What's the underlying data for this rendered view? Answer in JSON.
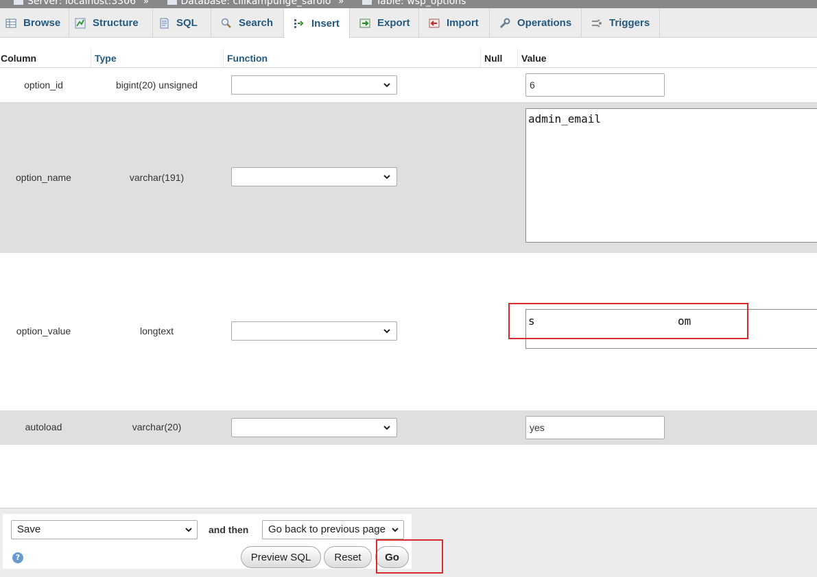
{
  "breadcrumb": {
    "server": "Server: localhost:3306",
    "database": "Database: cilikampunge_sarolo",
    "table": "Table: wsp_options",
    "separator": "»"
  },
  "tabs": [
    {
      "label": "Browse",
      "icon": "browse-icon",
      "active": false
    },
    {
      "label": "Structure",
      "icon": "structure-icon",
      "active": false
    },
    {
      "label": "SQL",
      "icon": "sql-icon",
      "active": false
    },
    {
      "label": "Search",
      "icon": "search-icon",
      "active": false
    },
    {
      "label": "Insert",
      "icon": "insert-icon",
      "active": true
    },
    {
      "label": "Export",
      "icon": "export-icon",
      "active": false
    },
    {
      "label": "Import",
      "icon": "import-icon",
      "active": false
    },
    {
      "label": "Operations",
      "icon": "operations-icon",
      "active": false
    },
    {
      "label": "Triggers",
      "icon": "triggers-icon",
      "active": false
    }
  ],
  "table": {
    "headers": {
      "column": "Column",
      "type": "Type",
      "function": "Function",
      "null": "Null",
      "value": "Value"
    },
    "rows": [
      {
        "column": "option_id",
        "type": "bigint(20) unsigned",
        "function": "",
        "value": "6"
      },
      {
        "column": "option_name",
        "type": "varchar(191)",
        "function": "",
        "value": "admin_email"
      },
      {
        "column": "option_value",
        "type": "longtext",
        "function": "",
        "value_start": "s",
        "value_end": "om"
      },
      {
        "column": "autoload",
        "type": "varchar(20)",
        "function": "",
        "value": "yes"
      }
    ]
  },
  "footer": {
    "action_select": "Save",
    "and_then_label": "and then",
    "after_select": "Go back to previous page",
    "preview_sql": "Preview SQL",
    "reset": "Reset",
    "go": "Go",
    "help_icon": "?"
  },
  "colors": {
    "link": "#235a81",
    "annotation": "#d92b2b",
    "row_alt": "#dfdfdf",
    "tab_bar": "#ececec"
  }
}
